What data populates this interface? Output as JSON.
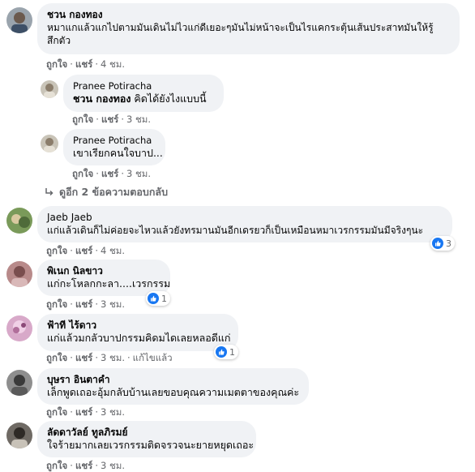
{
  "comments": [
    {
      "author": "ชวน กองทอง",
      "text_line1": "หมาแกแล้วแกไปตามมันเดินไม่ไวแก่ดีเยอะๆมันไม่หน้าจะเป็นไรแคกระตุ้นเส้นประสาทมันให้รู้",
      "text_line2": "สึกตัว",
      "like": "ถูกใจ",
      "share": "แชร์",
      "time": "4 ชม."
    },
    {
      "author": "Jaeb Jaeb",
      "text": "แก่แล้วเดินก็ไม่ค่อยจะไหวแล้วยังทรมานมันอีกเดรยวก็เป็นเหมือนหมาเวรกรรมมันมีจริงๆนะ",
      "like": "ถูกใจ",
      "share": "แชร์",
      "time": "4 ชม.",
      "reactions": "3"
    },
    {
      "author": "พิเนก นิลขาว",
      "text": "แก่กะโหลกกะลา....เวรกรรม",
      "like": "ถูกใจ",
      "share": "แชร์",
      "time": "3 ชม.",
      "reactions": "1"
    },
    {
      "author": "ฟ้าที ไร้ดาว",
      "text": "แก่แล้วมกลัวบาปกรรมคิดมไดเลยหลอดีแก่",
      "like": "ถูกใจ",
      "share": "แชร์",
      "time": "3 ชม.",
      "edited": "แก้ไขแล้ว",
      "reactions": "1"
    },
    {
      "author": "บุษรา อินตาคำ",
      "text": "เล็กพูดเถอะอุ้มกลับบ้านเลยขอบคุณความเมตตาของคุณค่ะ",
      "like": "ถูกใจ",
      "share": "แชร์",
      "time": "3 ชม."
    },
    {
      "author": "ลัดดาวัลย์ ทูลภิรมย์",
      "text": "ใจร้ายมากเลยเวรกรรมติดจรวจนะยายหยุดเถอะ",
      "like": "ถูกใจ",
      "share": "แชร์",
      "time": "3 ชม."
    }
  ],
  "replies": [
    {
      "author": "Pranee Potiracha",
      "mention": "ชวน กองทอง",
      "text": " คิดได้ยังไงแบบนี้",
      "like": "ถูกใจ",
      "share": "แชร์",
      "time": "3 ชม."
    },
    {
      "author": "Pranee Potiracha",
      "text": "เขาเรียกคนใจบาป...",
      "like": "ถูกใจ",
      "share": "แชร์",
      "time": "3 ชม."
    }
  ],
  "more_replies": "ดูอีก 2 ข้อความตอบกลับ",
  "colors": {
    "bubble": "#f0f2f5",
    "secondary_text": "#65676b",
    "like_blue": "#1877f2"
  }
}
